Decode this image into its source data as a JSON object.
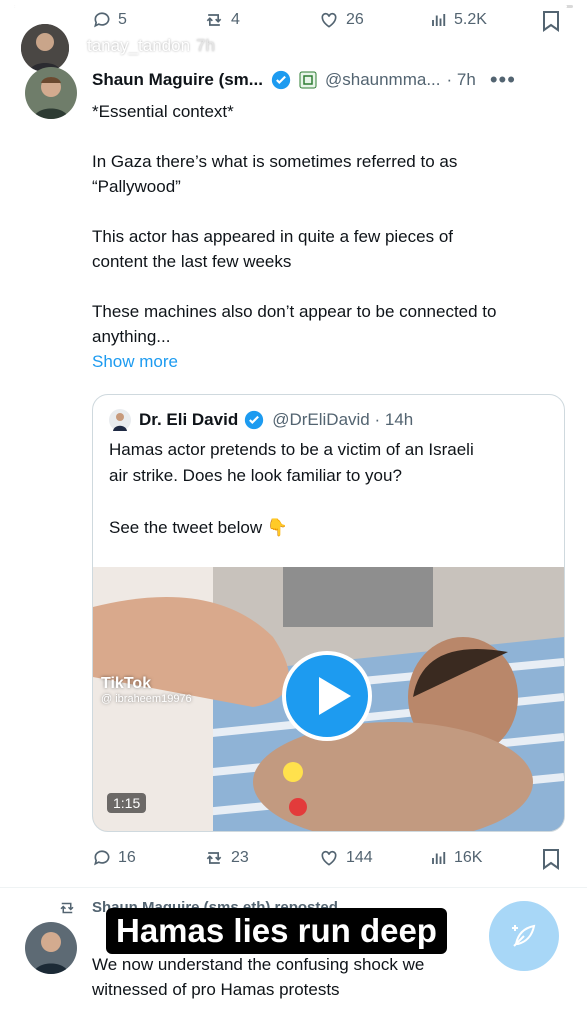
{
  "story": {
    "username": "tanay_tandon",
    "time": "7h",
    "progress": 0.99,
    "caption": "Hamas lies run deep"
  },
  "top_metrics": {
    "replies": "5",
    "reposts": "4",
    "likes": "26",
    "views": "5.2K"
  },
  "tweet": {
    "author_name": "Shaun Maguire (sm...",
    "handle": "@shaunmma...",
    "time": "· 7h",
    "lines": [
      "*Essential context*",
      "",
      "In Gaza there’s what is sometimes referred to as",
      "“Pallywood”",
      "",
      "This actor has appeared in quite a few pieces of",
      "content the last few weeks",
      "",
      "These machines also don’t appear to be connected to",
      "anything..."
    ],
    "show_more": "Show more",
    "metrics": {
      "replies": "16",
      "reposts": "23",
      "likes": "144",
      "views": "16K"
    }
  },
  "quote": {
    "author_name": "Dr. Eli David",
    "handle": "@DrEliDavid · 14h",
    "line1": "Hamas actor pretends to be a victim of an Israeli",
    "line2": "air strike. Does he look familiar to you?",
    "line3": "See the tweet below 👇",
    "video_duration": "1:15",
    "watermark_app": "TikTok",
    "watermark_user": "@ ibraheem19976"
  },
  "next_tweet": {
    "repost_label": "Shaun Maguire (sms eth) reposted",
    "line1": "We now understand the confusing shock we",
    "line2": "witnessed of pro Hamas protests"
  },
  "colors": {
    "accent": "#1d9bf0",
    "verified": "#1d9bf0",
    "text": "#0f1419",
    "muted": "#536471"
  }
}
